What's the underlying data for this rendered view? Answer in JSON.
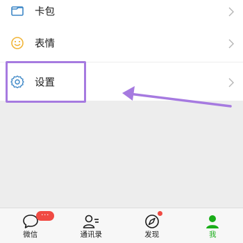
{
  "menu": {
    "items": [
      {
        "label": "卡包",
        "icon": "card-wallet-icon"
      },
      {
        "label": "表情",
        "icon": "smiley-icon"
      },
      {
        "label": "设置",
        "icon": "gear-icon"
      }
    ]
  },
  "tabbar": {
    "tabs": [
      {
        "label": "微信",
        "icon": "chat-icon",
        "badge": "···"
      },
      {
        "label": "通讯录",
        "icon": "contacts-icon"
      },
      {
        "label": "发现",
        "icon": "compass-icon"
      },
      {
        "label": "我",
        "icon": "person-icon"
      }
    ],
    "active_tab": "我"
  },
  "colors": {
    "accent": "#1aad19",
    "badge": "#f04a43",
    "annotation": "#a67ae0",
    "icon_blue": "#3b86c6",
    "icon_yellow": "#f1b436"
  }
}
